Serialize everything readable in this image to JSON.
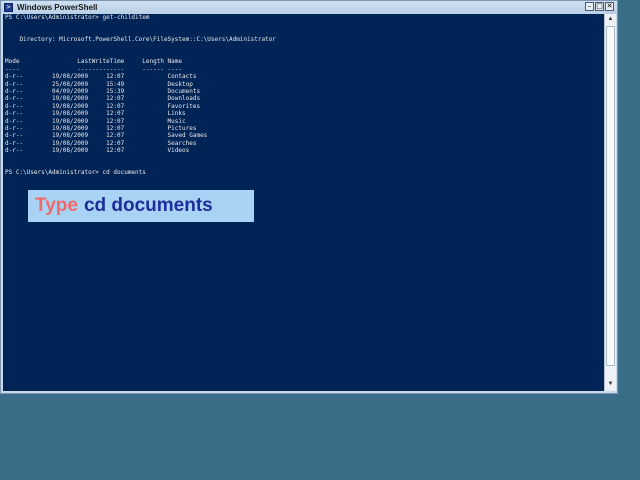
{
  "window": {
    "title": "Windows PowerShell",
    "icon_glyph": ">",
    "controls": {
      "minimize": "–",
      "maximize": "□",
      "close": "✕"
    }
  },
  "console": {
    "lines": [
      "PS C:\\Users\\Administrator> get-childitem",
      "",
      "",
      "    Directory: Microsoft.PowerShell.Core\\FileSystem::C:\\Users\\Administrator",
      "",
      "",
      "Mode                LastWriteTime     Length Name",
      "----                -------------     ------ ----",
      "d-r--        19/08/2009     12:07            Contacts",
      "d-r--        25/08/2009     15:49            Desktop",
      "d-r--        04/09/2009     15:39            Documents",
      "d-r--        19/08/2009     12:07            Downloads",
      "d-r--        19/08/2009     12:07            Favorites",
      "d-r--        19/08/2009     12:07            Links",
      "d-r--        19/08/2009     12:07            Music",
      "d-r--        19/08/2009     12:07            Pictures",
      "d-r--        19/08/2009     12:07            Saved Games",
      "d-r--        19/08/2009     12:07            Searches",
      "d-r--        19/08/2009     12:07            Videos",
      "",
      "",
      "PS C:\\Users\\Administrator> cd documents"
    ],
    "background": "#012456",
    "foreground": "#e8e8e8"
  },
  "scrollbar": {
    "up_arrow": "▲",
    "down_arrow": "▼"
  },
  "callout": {
    "verb": "Type",
    "command": "cd documents",
    "verb_color": "#f06a6a",
    "command_color": "#1d2d9a",
    "background": "#a8d3f5"
  }
}
